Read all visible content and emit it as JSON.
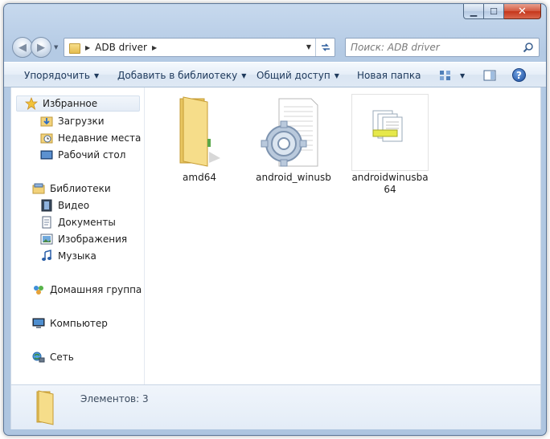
{
  "window": {
    "minimize": "▁",
    "maximize": "☐",
    "close": "✕"
  },
  "address": {
    "path": [
      "ADB driver"
    ]
  },
  "search": {
    "placeholder": "Поиск: ADB driver"
  },
  "toolbar": {
    "organize": "Упорядочить",
    "add_to_library": "Добавить в библиотеку",
    "share": "Общий доступ",
    "new_folder": "Новая папка"
  },
  "sidebar": {
    "favorites": {
      "label": "Избранное",
      "items": [
        "Загрузки",
        "Недавние места",
        "Рабочий стол"
      ]
    },
    "libraries": {
      "label": "Библиотеки",
      "items": [
        "Видео",
        "Документы",
        "Изображения",
        "Музыка"
      ]
    },
    "homegroup": "Домашняя группа",
    "computer": "Компьютер",
    "network": "Сеть"
  },
  "files": [
    {
      "name": "amd64",
      "icon": "folder-icon"
    },
    {
      "name": "android_winusb",
      "icon": "settings-file-icon"
    },
    {
      "name": "androidwinusba64",
      "icon": "catalog-file-icon"
    }
  ],
  "status": {
    "items_count": "Элементов: 3"
  }
}
